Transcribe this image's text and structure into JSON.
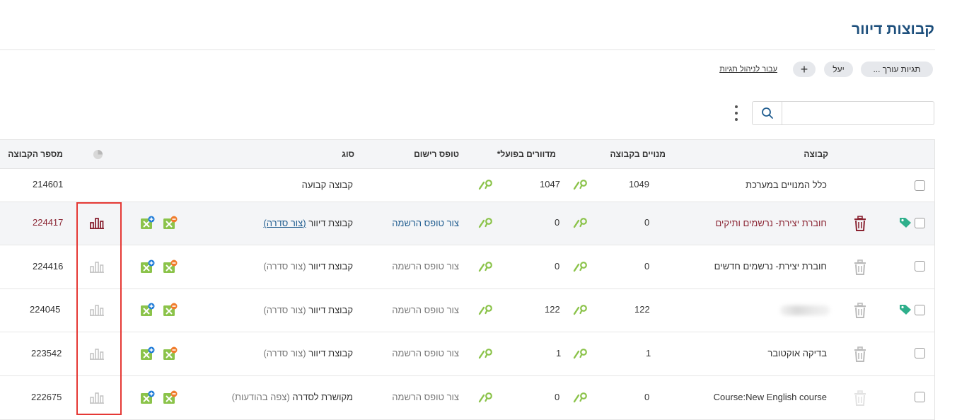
{
  "page": {
    "title": "קבוצות דיוור"
  },
  "tags": {
    "editor_chip": "תגיות עורך ...",
    "yael_chip": "יעל",
    "add_chip": "+",
    "manage_link": "עבור לניהול תגיות"
  },
  "search": {
    "value": "",
    "placeholder": ""
  },
  "table": {
    "headers": {
      "group": "קבוצה",
      "members": "מנויים בקבוצה",
      "mailed": "מדוורים בפועל*",
      "form": "טופס רישום",
      "type": "סוג",
      "group_id": "מספר הקבוצה"
    },
    "rows": [
      {
        "name": "כלל המנויים במערכת",
        "members": "1049",
        "mailed": "1047",
        "form": "",
        "type": "קבוצה קבועה",
        "type_extra": "",
        "id": "214601"
      },
      {
        "name": "חוברת יצירת- נרשמים ותיקים",
        "members": "0",
        "mailed": "0",
        "form": "צור טופס הרשמה",
        "type": "קבוצת דיוור",
        "type_extra": "(צור סדרה)",
        "id": "224417"
      },
      {
        "name": "חוברת יצירת- נרשמים חדשים",
        "members": "0",
        "mailed": "0",
        "form": "צור טופס הרשמה",
        "type": "קבוצת דיוור",
        "type_extra": "(צור סדרה)",
        "id": "224416"
      },
      {
        "name": "",
        "members": "122",
        "mailed": "122",
        "form": "צור טופס הרשמה",
        "type": "קבוצת דיוור",
        "type_extra": "(צור סדרה)",
        "id": "224045"
      },
      {
        "name": "בדיקה אוקטובר",
        "members": "1",
        "mailed": "1",
        "form": "צור טופס הרשמה",
        "type": "קבוצת דיוור",
        "type_extra": "(צור סדרה)",
        "id": "223542"
      },
      {
        "name": "Course:New English course",
        "members": "0",
        "mailed": "0",
        "form": "צור טופס הרשמה",
        "type": "מקושרת לסדרה",
        "type_extra": "(צפה בהודעות)",
        "id": "222675"
      }
    ]
  },
  "icons": {
    "search": "search-icon",
    "menu": "kebab-menu-icon",
    "stats_header": "pie-chart-icon",
    "edit": "pencil-search-icon",
    "trash": "trash-icon",
    "tag": "tag-icon",
    "excel_import": "excel-import-icon",
    "excel_export": "excel-export-icon",
    "stats": "bar-chart-icon"
  },
  "colors": {
    "title": "#1d4f7c",
    "active_row_text": "#8a2432",
    "tag": "#2eaf8b",
    "edit_icon": "#8bc34a",
    "highlight_box": "#e53935"
  }
}
